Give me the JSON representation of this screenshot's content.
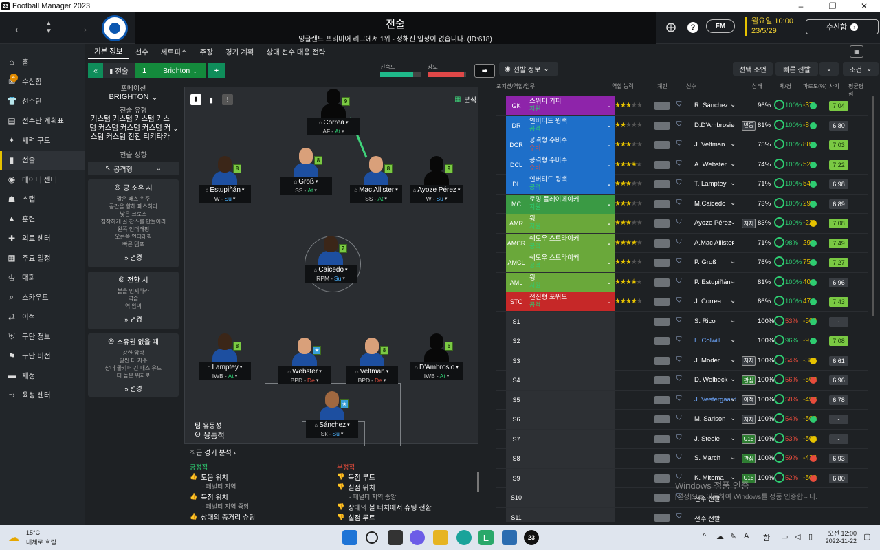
{
  "window": {
    "title": "Football Manager 2023",
    "controls": [
      "–",
      "❐",
      "✕"
    ]
  },
  "header": {
    "title": "전술",
    "subtitle": "잉글랜드 프리미어 리그에서 1위 - 정해진 일정이 없습니다. (ID:618)",
    "fm_label": "FM",
    "date_line1": "월요일 10:00",
    "date_line2": "23/5/29",
    "continue_label": "수신함"
  },
  "sidebar": {
    "items": [
      {
        "label": "홈",
        "icon": "home-icon"
      },
      {
        "label": "수신함",
        "icon": "inbox-icon",
        "badge": "4"
      },
      {
        "label": "선수단",
        "icon": "squad-icon"
      },
      {
        "label": "선수단 계획표",
        "icon": "planner-icon"
      },
      {
        "label": "세력 구도",
        "icon": "dynamics-icon"
      },
      {
        "label": "전술",
        "icon": "tactics-icon",
        "active": true
      },
      {
        "label": "데이터 센터",
        "icon": "data-icon"
      },
      {
        "label": "스탭",
        "icon": "staff-icon"
      },
      {
        "label": "훈련",
        "icon": "training-icon"
      },
      {
        "label": "의료 센터",
        "icon": "medical-icon"
      },
      {
        "label": "주요 일정",
        "icon": "calendar-icon"
      },
      {
        "label": "대회",
        "icon": "trophy-icon"
      },
      {
        "label": "스카우트",
        "icon": "scout-icon"
      },
      {
        "label": "이적",
        "icon": "transfer-icon"
      },
      {
        "label": "구단 정보",
        "icon": "club-icon"
      },
      {
        "label": "구단 비전",
        "icon": "vision-icon"
      },
      {
        "label": "재정",
        "icon": "finance-icon"
      },
      {
        "label": "육성 센터",
        "icon": "development-icon"
      }
    ]
  },
  "tabs": [
    "기본 정보",
    "선수",
    "세트피스",
    "주장",
    "경기 계획",
    "상대 선수 대응 전략"
  ],
  "squadbar": {
    "label": "전술",
    "number": "1",
    "team": "Brighton"
  },
  "meters": {
    "familiarity_label": "친숙도",
    "strength_label": "강도",
    "familiarity": 0.8,
    "strength": 0.95
  },
  "left": {
    "formation_label": "포메이션",
    "formation": "BRIGHTON",
    "style_label": "전술 유형",
    "style": "커스텀 커스텀 커스텀 커스텀 커스텀 커스텀 커스텀 커스텀 커스텀 전진 티키타카",
    "mentality_label": "전술 성향",
    "mentality": "공격형",
    "in_poss": {
      "title": "공 소유 시",
      "lines": [
        "짧은 패스 위주",
        "공간을 향해 패스하라",
        "낮은 크로스",
        "침착하게 골 찬스를 만들어라",
        "왼쪽 언더래핑",
        "오른쪽 언더래핑",
        "빠른 템포"
      ],
      "change": "변경"
    },
    "transition": {
      "title": "전환 시",
      "lines": [
        "볼을 인지하라",
        "역습",
        "역 압박"
      ],
      "change": "변경"
    },
    "out_poss": {
      "title": "소유권 없을 때",
      "lines": [
        "강한 압박",
        "훨씬 더 자주",
        "상대 골키퍼 긴 패스 유도",
        "더 높은 위치로"
      ],
      "change": "변경"
    }
  },
  "pitch": {
    "analysis_label": "분석",
    "fluidity_label": "팀 유동성",
    "fluidity": "융통적",
    "players": [
      {
        "name": "Correa",
        "role": "AF",
        "duty": "At",
        "rating": "9",
        "skin": "sil"
      },
      {
        "name": "Estupiñán",
        "role": "W",
        "duty": "Su",
        "rating": "8",
        "skin": "dk"
      },
      {
        "name": "Groß",
        "role": "SS",
        "duty": "At",
        "rating": "8",
        "skin": "lt"
      },
      {
        "name": "Mac Allister",
        "role": "SS",
        "duty": "At",
        "rating": "8",
        "skin": "lt"
      },
      {
        "name": "Ayoze Pérez",
        "role": "W",
        "duty": "Su",
        "rating": "9",
        "skin": "sil"
      },
      {
        "name": "Caicedo",
        "role": "RPM",
        "duty": "Su",
        "rating": "7",
        "skin": "dk"
      },
      {
        "name": "Lamptey",
        "role": "IWB",
        "duty": "At",
        "rating": "8",
        "skin": "dk"
      },
      {
        "name": "Webster",
        "role": "BPD",
        "duty": "De",
        "rating": "★",
        "skin": "lt"
      },
      {
        "name": "Veltman",
        "role": "BPD",
        "duty": "De",
        "rating": "8",
        "skin": "lt"
      },
      {
        "name": "D'Ambrosio",
        "role": "IWB",
        "duty": "At",
        "rating": "6",
        "skin": "sil"
      },
      {
        "name": "Sánchez",
        "role": "Sk",
        "duty": "Su",
        "rating": "★",
        "skin": "md"
      }
    ]
  },
  "analysis": {
    "title": "최근 경기 분석",
    "pos_label": "긍정적",
    "neg_label": "부정적",
    "pos": [
      {
        "t": "도움 위치",
        "s": "- 페널티 지역"
      },
      {
        "t": "득점 위치",
        "s": "- 페널티 지역 중앙"
      },
      {
        "t": "상대의 중거리 슈팅",
        "s": ""
      }
    ],
    "neg": [
      {
        "t": "득점 루트",
        "s": ""
      },
      {
        "t": "실점 위치",
        "s": "- 페널티 지역 중앙"
      },
      {
        "t": "상대의 볼 터치에서 슈팅 전환",
        "s": ""
      },
      {
        "t": "실점 루트",
        "s": ""
      }
    ]
  },
  "right": {
    "view_label": "선발 정보",
    "buttons": [
      "선택 조언",
      "빠른 선발",
      "조건"
    ],
    "headers": [
      "포지션/역할/임무",
      "역할 능력",
      "계인",
      "선수",
      "상태",
      "체/경",
      "파로도(%)",
      "사기",
      "평균평점"
    ],
    "rows": [
      {
        "pos": "GK",
        "role": "스위퍼 키퍼",
        "duty": "지원",
        "color": "#8e24aa",
        "stars": 3,
        "player": "R. Sánchez",
        "cond": "96%",
        "sharp": "100%",
        "val": "-37",
        "avg": "7.04",
        "avgc": "#7ac943",
        "fit": "#2ecc71"
      },
      {
        "pos": "DR",
        "role": "인버티드 윙백",
        "duty": "공격",
        "color": "#1e6fc9",
        "stars": 2,
        "player": "D.D'Ambrosio",
        "tag": "반등",
        "cond": "81%",
        "sharp": "100%",
        "val": "-8",
        "avg": "6.80",
        "avgc": "#3a3e43",
        "fit": "#2ecc71"
      },
      {
        "pos": "DCR",
        "role": "공격형 수비수",
        "duty": "수비",
        "color": "#1e6fc9",
        "stars": 3,
        "player": "J. Veltman",
        "cond": "75%",
        "sharp": "100%",
        "val": "88",
        "avg": "7.03",
        "avgc": "#7ac943",
        "fit": "#2ecc71"
      },
      {
        "pos": "DCL",
        "role": "공격형 수비수",
        "duty": "수비",
        "color": "#1e6fc9",
        "stars": 3.5,
        "player": "A. Webster",
        "cond": "74%",
        "sharp": "100%",
        "val": "52",
        "avg": "7.22",
        "avgc": "#7ac943",
        "fit": "#2ecc71"
      },
      {
        "pos": "DL",
        "role": "인버티드 윙백",
        "duty": "공격",
        "color": "#1e6fc9",
        "stars": 3,
        "player": "T. Lamptey",
        "cond": "71%",
        "sharp": "100%",
        "val": "54",
        "avg": "6.98",
        "avgc": "#3a3e43",
        "fit": "#2ecc71"
      },
      {
        "pos": "MC",
        "role": "로밍 플레이메이커",
        "duty": "지원",
        "color": "#3a9a44",
        "stars": 3,
        "player": "M.Caicedo",
        "cond": "73%",
        "sharp": "100%",
        "val": "298",
        "avg": "6.89",
        "avgc": "#3a3e43",
        "fit": "#2ecc71"
      },
      {
        "pos": "AMR",
        "role": "윙",
        "duty": "지원",
        "color": "#6aa83a",
        "stars": 3,
        "player": "Ayoze Pérez",
        "tag": "지지",
        "cond": "83%",
        "sharp": "100%",
        "val": "-22",
        "avg": "7.08",
        "avgc": "#7ac943",
        "fit": "#e6c200"
      },
      {
        "pos": "AMCR",
        "role": "쉐도우 스트라이커",
        "duty": "공격",
        "color": "#6aa83a",
        "stars": 4,
        "player": "A.Mac Allister",
        "cond": "71%",
        "sharp": "98%",
        "val": "290",
        "avg": "7.49",
        "avgc": "#7ac943",
        "fit": "#2ecc71"
      },
      {
        "pos": "AMCL",
        "role": "쉐도우 스트라이커",
        "duty": "공격",
        "color": "#6aa83a",
        "stars": 3,
        "player": "P. Groß",
        "cond": "76%",
        "sharp": "100%",
        "val": "75",
        "avg": "7.27",
        "avgc": "#7ac943",
        "fit": "#2ecc71"
      },
      {
        "pos": "AML",
        "role": "윙",
        "duty": "지원",
        "color": "#6aa83a",
        "stars": 3.5,
        "player": "P. Estupiñán",
        "cond": "81%",
        "sharp": "100%",
        "val": "40",
        "avg": "6.96",
        "avgc": "#3a3e43",
        "fit": "#2ecc71"
      },
      {
        "pos": "STC",
        "role": "전진형 포워드",
        "duty": "공격",
        "color": "#c62828",
        "stars": 4,
        "player": "J. Correa",
        "cond": "86%",
        "sharp": "100%",
        "val": "47",
        "avg": "7.43",
        "avgc": "#7ac943",
        "fit": "#2ecc71"
      },
      {
        "pos": "S1",
        "player": "S. Rico",
        "cond": "100%",
        "sharp": "53%",
        "val": "-500",
        "avg": "-",
        "avgc": "#3a3e43",
        "fit": "#2ecc71"
      },
      {
        "pos": "S2",
        "player": "L. Colwill",
        "cond": "100%",
        "sharp": "96%",
        "val": "-97",
        "avg": "7.08",
        "avgc": "#7ac943",
        "fit": "#2ecc71"
      },
      {
        "pos": "S3",
        "player": "J. Moder",
        "tag": "지지",
        "cond": "100%",
        "sharp": "54%",
        "val": "-386",
        "avg": "6.61",
        "avgc": "#3a3e43",
        "fit": "#e6c200"
      },
      {
        "pos": "S4",
        "player": "D. Welbeck",
        "tag": "관심",
        "cond": "100%",
        "sharp": "56%",
        "val": "-500",
        "avg": "6.96",
        "avgc": "#3a3e43",
        "fit": "#e74c3c"
      },
      {
        "pos": "S5",
        "player": "J. Vestergaard",
        "tag": "이적",
        "cond": "100%",
        "sharp": "58%",
        "val": "-492",
        "avg": "6.78",
        "avgc": "#3a3e43",
        "fit": "#e74c3c"
      },
      {
        "pos": "S6",
        "player": "M. Sarison",
        "tag": "지지",
        "cond": "100%",
        "sharp": "54%",
        "val": "-500",
        "avg": "-",
        "avgc": "#3a3e43",
        "fit": "#2ecc71"
      },
      {
        "pos": "S7",
        "player": "J. Steele",
        "tag": "U18",
        "cond": "100%",
        "sharp": "53%",
        "val": "-500",
        "avg": "-",
        "avgc": "#3a3e43",
        "fit": "#e6c200"
      },
      {
        "pos": "S8",
        "player": "S. March",
        "tag": "관심",
        "cond": "100%",
        "sharp": "59%",
        "val": "-436",
        "avg": "6.93",
        "avgc": "#3a3e43",
        "fit": "#e74c3c"
      },
      {
        "pos": "S9",
        "player": "K. Mitoma",
        "tag": "U18",
        "cond": "100%",
        "sharp": "52%",
        "val": "-500",
        "avg": "6.80",
        "avgc": "#3a3e43",
        "fit": "#e74c3c"
      },
      {
        "pos": "S10",
        "player": "선수 선발",
        "cond": "",
        "sharp": "",
        "val": "",
        "avg": "",
        "avgc": "transparent",
        "fit": "transparent"
      },
      {
        "pos": "S11",
        "player": "선수 선발",
        "cond": "",
        "sharp": "",
        "val": "",
        "avg": "",
        "avgc": "transparent",
        "fit": "transparent"
      }
    ]
  },
  "watermark": {
    "line1": "Windows 정품 인증",
    "line2": "[설정]으로 이동하여 Windows를 정품 인증합니다."
  },
  "taskbar": {
    "temp": "15°C",
    "weather": "대체로 흐림",
    "time": "오전 12:00",
    "date": "2022-11-22",
    "lang": "한"
  }
}
